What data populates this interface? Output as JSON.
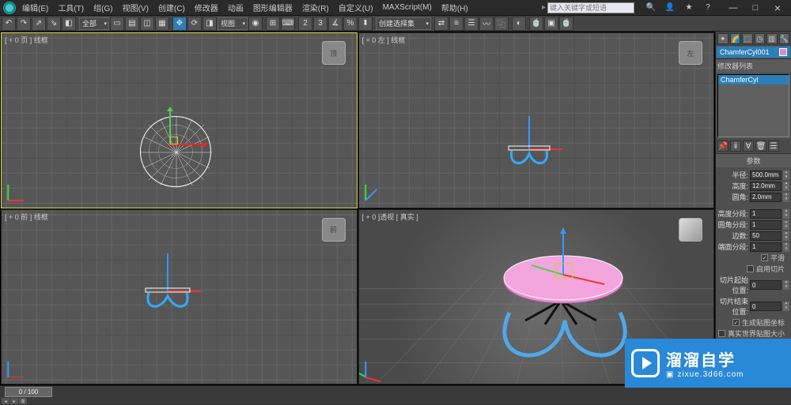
{
  "menu": [
    "编辑(E)",
    "工具(T)",
    "组(G)",
    "视图(V)",
    "创建(C)",
    "修改器",
    "动画",
    "图形编辑器",
    "渲染(R)",
    "自定义(U)",
    "MAXScript(M)",
    "帮助(H)"
  ],
  "search_placeholder": "键入关键字或短语",
  "toolbar": {
    "selset": "全部",
    "snap": "视图",
    "createsel": "创建选择集"
  },
  "viewports": {
    "top": "[ + 0 页 ] 线框",
    "front": "[ + 0 前 ] 线框",
    "side": "[ + 0 左 ] 线框",
    "persp": "[ + 0 ]透视 [ 真实 ]"
  },
  "panel": {
    "objname": "ChamferCyl001",
    "list_header": "修改器列表",
    "list_item": "ChamferCyl",
    "params_header": "参数",
    "radius_lbl": "半径:",
    "radius_val": "500.0mm",
    "height_lbl": "高度:",
    "height_val": "12.0mm",
    "fillet_lbl": "圆角:",
    "fillet_val": "2.0mm",
    "hseg_lbl": "高度分段:",
    "hseg_val": "1",
    "fseg_lbl": "圆角分段:",
    "fseg_val": "1",
    "sides_lbl": "边数:",
    "sides_val": "50",
    "cseg_lbl": "端面分段:",
    "cseg_val": "1",
    "smooth_lbl": "平滑",
    "smooth_chk": true,
    "sliceon_lbl": "启用切片",
    "sliceon_chk": false,
    "slicefrom_lbl": "切片起始位置:",
    "slicefrom_val": "0",
    "sliceto_lbl": "切片结束位置:",
    "sliceto_val": "0",
    "genmap_lbl": "生成贴图坐标",
    "genmap_chk": true,
    "realworld_lbl": "真实世界贴图大小",
    "realworld_chk": false
  },
  "timeline": {
    "frame": "0 / 100"
  },
  "watermark": {
    "title": "溜溜自学",
    "sub": "zixue.3d66.com"
  }
}
